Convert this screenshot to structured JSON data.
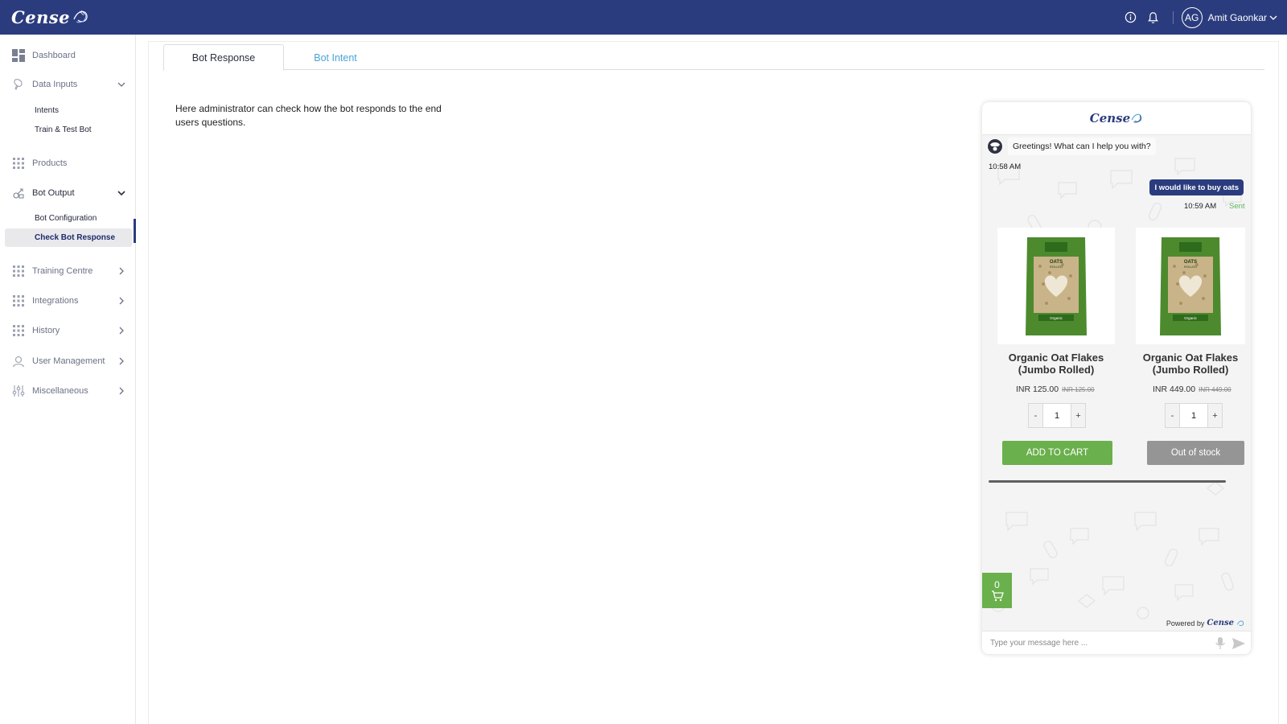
{
  "app": {
    "brand": "Cense"
  },
  "header": {
    "user_initials": "AG",
    "user_name": "Amit Gaonkar"
  },
  "sidebar": {
    "items": [
      {
        "label": "Dashboard"
      },
      {
        "label": "Data Inputs"
      },
      {
        "label": "Products"
      },
      {
        "label": "Bot Output"
      },
      {
        "label": "Training Centre"
      },
      {
        "label": "Integrations"
      },
      {
        "label": "History"
      },
      {
        "label": "User Management"
      },
      {
        "label": "Miscellaneous"
      }
    ],
    "data_inputs_sub": [
      {
        "label": "Intents"
      },
      {
        "label": "Train & Test Bot"
      }
    ],
    "bot_output_sub": [
      {
        "label": "Bot Configuration"
      },
      {
        "label": "Check Bot Response"
      }
    ]
  },
  "tabs": [
    {
      "label": "Bot Response"
    },
    {
      "label": "Bot Intent"
    }
  ],
  "main": {
    "description": "Here administrator can check how the bot responds to the end users questions."
  },
  "chat": {
    "brand": "Cense",
    "greeting": "Greetings! What can I help you with?",
    "greeting_time": "10:58 AM",
    "user_message": "I would like to buy oats",
    "user_time": "10:59 AM",
    "sent_status": "Sent",
    "products": [
      {
        "title": "Organic Oat Flakes (Jumbo Rolled)",
        "price": "INR 125.00",
        "mrp": "INR 125.00",
        "quantity": "1",
        "button": "ADD TO CART",
        "pack_label": "OATS",
        "pack_sub": "ROLLED",
        "pack_tag": "Organic"
      },
      {
        "title": "Organic Oat Flakes (Jumbo Rolled)",
        "price": "INR 449.00",
        "mrp": "INR 449.00",
        "quantity": "1",
        "button": "Out of stock",
        "pack_label": "OATS",
        "pack_sub": "ROLLED",
        "pack_tag": "Organic"
      }
    ],
    "minus": "-",
    "plus": "+",
    "cart_count": "0",
    "powered_by": "Powered by",
    "input_placeholder": "Type your message here ..."
  },
  "colors": {
    "topbar": "#2b3c7e",
    "accent_green": "#6ab04c",
    "link_blue": "#4aa3d6",
    "oos_gray": "#959595"
  }
}
